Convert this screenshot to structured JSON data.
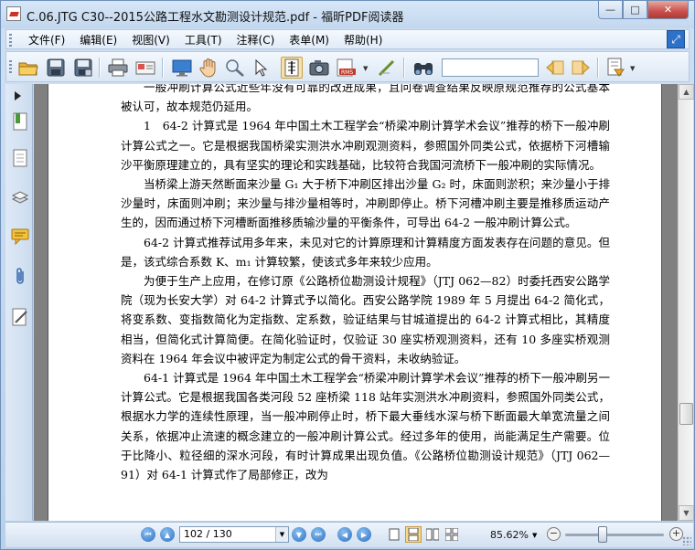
{
  "window": {
    "title": "C.06.JTG C30--2015公路工程水文勘测设计规范.pdf - 福昕PDF阅读器",
    "minimize": "—",
    "maximize": "□",
    "close": "✕"
  },
  "menu": [
    "文件(F)",
    "编辑(E)",
    "视图(V)",
    "工具(T)",
    "注释(C)",
    "表单(M)",
    "帮助(H)"
  ],
  "toolbar": {
    "search_value": ""
  },
  "document": {
    "paragraphs": [
      "一般冲刷计算公式近些年没有可靠的改进成果，且问卷调查结果反映原规范推荐的公式基本被认可，故本规范仍延用。",
      "1　64-2 计算式是 1964 年中国土木工程学会“桥梁冲刷计算学术会议”推荐的桥下一般冲刷计算公式之一。它是根据我国桥梁实测洪水冲刷观测资料，参照国外同类公式，依据桥下河槽输沙平衡原理建立的，具有坚实的理论和实践基础，比较符合我国河流桥下一般冲刷的实际情况。",
      "当桥梁上游天然断面来沙量 G₁ 大于桥下冲刷区排出沙量 G₂ 时，床面则淤积；来沙量小于排沙量时，床面则冲刷；来沙量与排沙量相等时，冲刷即停止。桥下河槽冲刷主要是推移质运动产生的，因而通过桥下河槽断面推移质输沙量的平衡条件，可导出 64-2 一般冲刷计算公式。",
      "64-2 计算式推荐试用多年来，未见对它的计算原理和计算精度方面发表存在问题的意见。但是，该式综合系数 K、m₁ 计算较繁，使该式多年来较少应用。",
      "为便于生产上应用，在修订原《公路桥位勘测设计规程》（JTJ 062—82）时委托西安公路学院（现为长安大学）对 64-2 计算式予以简化。西安公路学院 1989 年 5 月提出 64-2 简化式，将变系数、变指数简化为定指数、定系数，验证结果与甘城道提出的 64-2 计算式相比，其精度相当，但简化式计算简便。在简化验证时，仅验证 30 座实桥观测资料，还有 10 多座实桥观测资料在 1964 年会议中被评定为制定公式的骨干资料，未收纳验证。",
      "64-1 计算式是 1964 年中国土木工程学会“桥梁冲刷计算学术会议”推荐的桥下一般冲刷另一计算公式。它是根据我国各类河段 52 座桥梁 118 站年实测洪水冲刷资料，参照国外同类公式，根据水力学的连续性原理，当一般冲刷停止时，桥下最大垂线水深与桥下断面最大单宽流量之间关系，依据冲止流速的概念建立的一般冲刷计算公式。经过多年的使用，尚能满足生产需要。位于比降小、粒径细的深水河段，有时计算成果出现负值。《公路桥位勘测设计规范》（JTJ 062—91）对 64-1 计算式作了局部修正，改为"
    ]
  },
  "status": {
    "page_display": "102 / 130",
    "current_page": 102,
    "total_pages": 130,
    "zoom": "85.62%",
    "zoom_minus": "−",
    "zoom_plus": "+"
  }
}
